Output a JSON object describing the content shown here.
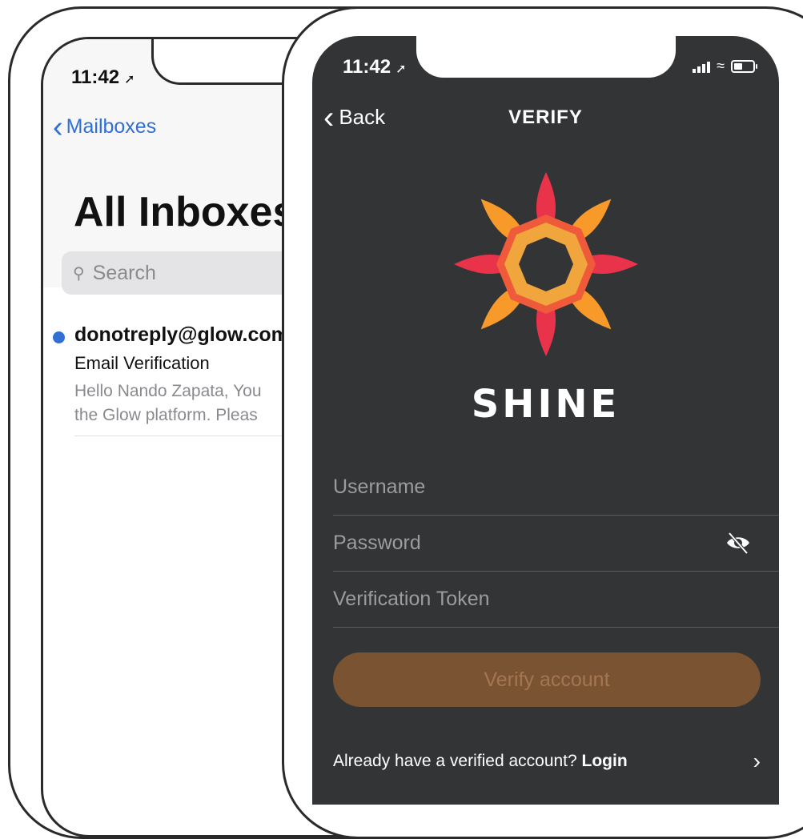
{
  "mail": {
    "time": "11:42",
    "back_label": "Mailboxes",
    "title": "All Inboxes",
    "search_placeholder": "Search",
    "message": {
      "from": "donotreply@glow.com",
      "subject": "Email Verification",
      "preview_line1": "Hello Nando Zapata, You",
      "preview_line2": "the Glow platform. Pleas"
    },
    "accent_color": "#2f6fd6"
  },
  "shine": {
    "time": "11:42",
    "back_label": "Back",
    "nav_title": "VERIFY",
    "brand": "SHINE",
    "fields": {
      "username_placeholder": "Username",
      "password_placeholder": "Password",
      "token_placeholder": "Verification Token"
    },
    "verify_button": "Verify account",
    "login_prompt": "Already have a verified account?",
    "login_link": "Login",
    "colors": {
      "background": "#323436",
      "button": "#7a5332",
      "logo_primary": "#e8334b",
      "logo_secondary": "#f79a2a"
    },
    "icons": {
      "location": "location-arrow-icon",
      "signal": "cellular-signal-icon",
      "wifi": "wifi-icon",
      "battery": "battery-icon",
      "password_toggle": "eye-slash-icon"
    }
  }
}
